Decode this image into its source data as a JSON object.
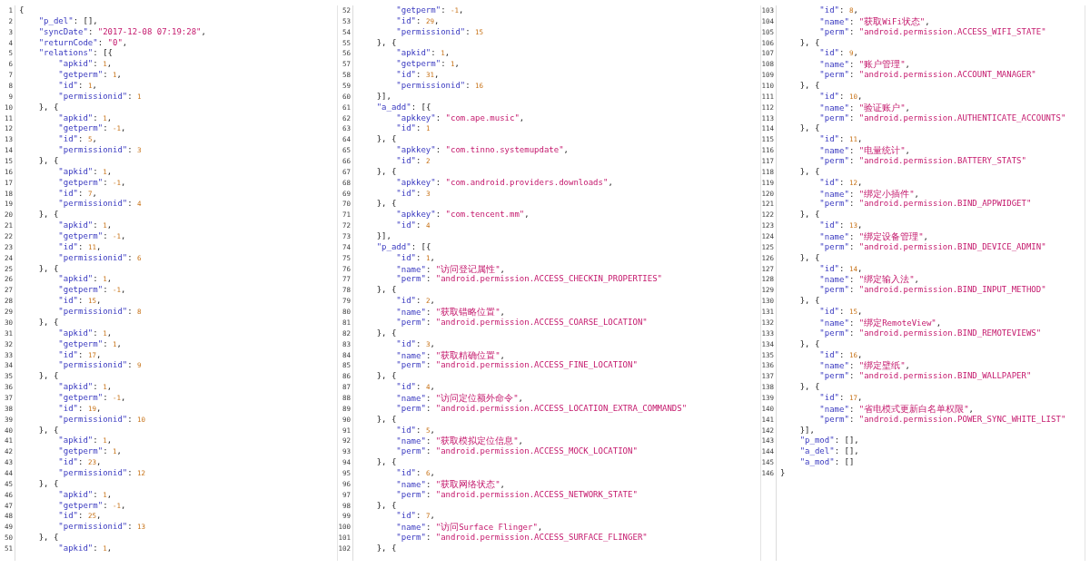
{
  "panes": [
    {
      "lines": [
        {
          "number": "1",
          "code": "{"
        },
        {
          "number": "2",
          "code": "    \"p_del\": [],"
        },
        {
          "number": "3",
          "code": "    \"syncDate\": \"2017-12-08 07:19:28\","
        },
        {
          "number": "4",
          "code": "    \"returnCode\": \"0\","
        },
        {
          "number": "5",
          "code": "    \"relations\": [{"
        },
        {
          "number": "6",
          "code": "        \"apkid\": 1,"
        },
        {
          "number": "7",
          "code": "        \"getperm\": 1,"
        },
        {
          "number": "8",
          "code": "        \"id\": 1,"
        },
        {
          "number": "9",
          "code": "        \"permissionid\": 1"
        },
        {
          "number": "10",
          "code": "    }, {"
        },
        {
          "number": "11",
          "code": "        \"apkid\": 1,"
        },
        {
          "number": "12",
          "code": "        \"getperm\": -1,"
        },
        {
          "number": "13",
          "code": "        \"id\": 5,"
        },
        {
          "number": "14",
          "code": "        \"permissionid\": 3"
        },
        {
          "number": "15",
          "code": "    }, {"
        },
        {
          "number": "16",
          "code": "        \"apkid\": 1,"
        },
        {
          "number": "17",
          "code": "        \"getperm\": -1,"
        },
        {
          "number": "18",
          "code": "        \"id\": 7,"
        },
        {
          "number": "19",
          "code": "        \"permissionid\": 4"
        },
        {
          "number": "20",
          "code": "    }, {"
        },
        {
          "number": "21",
          "code": "        \"apkid\": 1,"
        },
        {
          "number": "22",
          "code": "        \"getperm\": -1,"
        },
        {
          "number": "23",
          "code": "        \"id\": 11,"
        },
        {
          "number": "24",
          "code": "        \"permissionid\": 6"
        },
        {
          "number": "25",
          "code": "    }, {"
        },
        {
          "number": "26",
          "code": "        \"apkid\": 1,"
        },
        {
          "number": "27",
          "code": "        \"getperm\": -1,"
        },
        {
          "number": "28",
          "code": "        \"id\": 15,"
        },
        {
          "number": "29",
          "code": "        \"permissionid\": 8"
        },
        {
          "number": "30",
          "code": "    }, {"
        },
        {
          "number": "31",
          "code": "        \"apkid\": 1,"
        },
        {
          "number": "32",
          "code": "        \"getperm\": 1,"
        },
        {
          "number": "33",
          "code": "        \"id\": 17,"
        },
        {
          "number": "34",
          "code": "        \"permissionid\": 9"
        },
        {
          "number": "35",
          "code": "    }, {"
        },
        {
          "number": "36",
          "code": "        \"apkid\": 1,"
        },
        {
          "number": "37",
          "code": "        \"getperm\": -1,"
        },
        {
          "number": "38",
          "code": "        \"id\": 19,"
        },
        {
          "number": "39",
          "code": "        \"permissionid\": 10"
        },
        {
          "number": "40",
          "code": "    }, {"
        },
        {
          "number": "41",
          "code": "        \"apkid\": 1,"
        },
        {
          "number": "42",
          "code": "        \"getperm\": 1,"
        },
        {
          "number": "43",
          "code": "        \"id\": 23,"
        },
        {
          "number": "44",
          "code": "        \"permissionid\": 12"
        },
        {
          "number": "45",
          "code": "    }, {"
        },
        {
          "number": "46",
          "code": "        \"apkid\": 1,"
        },
        {
          "number": "47",
          "code": "        \"getperm\": -1,"
        },
        {
          "number": "48",
          "code": "        \"id\": 25,"
        },
        {
          "number": "49",
          "code": "        \"permissionid\": 13"
        },
        {
          "number": "50",
          "code": "    }, {"
        },
        {
          "number": "51",
          "code": "        \"apkid\": 1,"
        }
      ]
    },
    {
      "lines": [
        {
          "number": "52",
          "code": "        \"getperm\": -1,"
        },
        {
          "number": "53",
          "code": "        \"id\": 29,"
        },
        {
          "number": "54",
          "code": "        \"permissionid\": 15"
        },
        {
          "number": "55",
          "code": "    }, {"
        },
        {
          "number": "56",
          "code": "        \"apkid\": 1,"
        },
        {
          "number": "57",
          "code": "        \"getperm\": 1,"
        },
        {
          "number": "58",
          "code": "        \"id\": 31,"
        },
        {
          "number": "59",
          "code": "        \"permissionid\": 16"
        },
        {
          "number": "60",
          "code": "    }],"
        },
        {
          "number": "61",
          "code": "    \"a_add\": [{"
        },
        {
          "number": "62",
          "code": "        \"apkkey\": \"com.ape.music\","
        },
        {
          "number": "63",
          "code": "        \"id\": 1"
        },
        {
          "number": "64",
          "code": "    }, {"
        },
        {
          "number": "65",
          "code": "        \"apkkey\": \"com.tinno.systemupdate\","
        },
        {
          "number": "66",
          "code": "        \"id\": 2"
        },
        {
          "number": "67",
          "code": "    }, {"
        },
        {
          "number": "68",
          "code": "        \"apkkey\": \"com.android.providers.downloads\","
        },
        {
          "number": "69",
          "code": "        \"id\": 3"
        },
        {
          "number": "70",
          "code": "    }, {"
        },
        {
          "number": "71",
          "code": "        \"apkkey\": \"com.tencent.mm\","
        },
        {
          "number": "72",
          "code": "        \"id\": 4"
        },
        {
          "number": "73",
          "code": "    }],"
        },
        {
          "number": "74",
          "code": "    \"p_add\": [{"
        },
        {
          "number": "75",
          "code": "        \"id\": 1,"
        },
        {
          "number": "76",
          "code": "        \"name\": \"访问登记属性\","
        },
        {
          "number": "77",
          "code": "        \"perm\": \"android.permission.ACCESS_CHECKIN_PROPERTIES\""
        },
        {
          "number": "78",
          "code": "    }, {"
        },
        {
          "number": "79",
          "code": "        \"id\": 2,"
        },
        {
          "number": "80",
          "code": "        \"name\": \"获取错略位置\","
        },
        {
          "number": "81",
          "code": "        \"perm\": \"android.permission.ACCESS_COARSE_LOCATION\""
        },
        {
          "number": "82",
          "code": "    }, {"
        },
        {
          "number": "83",
          "code": "        \"id\": 3,"
        },
        {
          "number": "84",
          "code": "        \"name\": \"获取精确位置\","
        },
        {
          "number": "85",
          "code": "        \"perm\": \"android.permission.ACCESS_FINE_LOCATION\""
        },
        {
          "number": "86",
          "code": "    }, {"
        },
        {
          "number": "87",
          "code": "        \"id\": 4,"
        },
        {
          "number": "88",
          "code": "        \"name\": \"访问定位额外命令\","
        },
        {
          "number": "89",
          "code": "        \"perm\": \"android.permission.ACCESS_LOCATION_EXTRA_COMMANDS\""
        },
        {
          "number": "90",
          "code": "    }, {"
        },
        {
          "number": "91",
          "code": "        \"id\": 5,"
        },
        {
          "number": "92",
          "code": "        \"name\": \"获取模拟定位信息\","
        },
        {
          "number": "93",
          "code": "        \"perm\": \"android.permission.ACCESS_MOCK_LOCATION\""
        },
        {
          "number": "94",
          "code": "    }, {"
        },
        {
          "number": "95",
          "code": "        \"id\": 6,"
        },
        {
          "number": "96",
          "code": "        \"name\": \"获取网络状态\","
        },
        {
          "number": "97",
          "code": "        \"perm\": \"android.permission.ACCESS_NETWORK_STATE\""
        },
        {
          "number": "98",
          "code": "    }, {"
        },
        {
          "number": "99",
          "code": "        \"id\": 7,"
        },
        {
          "number": "100",
          "code": "        \"name\": \"访问Surface Flinger\","
        },
        {
          "number": "101",
          "code": "        \"perm\": \"android.permission.ACCESS_SURFACE_FLINGER\""
        },
        {
          "number": "102",
          "code": "    }, {"
        }
      ]
    },
    {
      "lines": [
        {
          "number": "103",
          "code": "        \"id\": 8,"
        },
        {
          "number": "104",
          "code": "        \"name\": \"获取WiFi状态\","
        },
        {
          "number": "105",
          "code": "        \"perm\": \"android.permission.ACCESS_WIFI_STATE\""
        },
        {
          "number": "106",
          "code": "    }, {"
        },
        {
          "number": "107",
          "code": "        \"id\": 9,"
        },
        {
          "number": "108",
          "code": "        \"name\": \"账户管理\","
        },
        {
          "number": "109",
          "code": "        \"perm\": \"android.permission.ACCOUNT_MANAGER\""
        },
        {
          "number": "110",
          "code": "    }, {"
        },
        {
          "number": "111",
          "code": "        \"id\": 10,"
        },
        {
          "number": "112",
          "code": "        \"name\": \"验证账户\","
        },
        {
          "number": "113",
          "code": "        \"perm\": \"android.permission.AUTHENTICATE_ACCOUNTS\""
        },
        {
          "number": "114",
          "code": "    }, {"
        },
        {
          "number": "115",
          "code": "        \"id\": 11,"
        },
        {
          "number": "116",
          "code": "        \"name\": \"电量统计\","
        },
        {
          "number": "117",
          "code": "        \"perm\": \"android.permission.BATTERY_STATS\""
        },
        {
          "number": "118",
          "code": "    }, {"
        },
        {
          "number": "119",
          "code": "        \"id\": 12,"
        },
        {
          "number": "120",
          "code": "        \"name\": \"绑定小插件\","
        },
        {
          "number": "121",
          "code": "        \"perm\": \"android.permission.BIND_APPWIDGET\""
        },
        {
          "number": "122",
          "code": "    }, {"
        },
        {
          "number": "123",
          "code": "        \"id\": 13,"
        },
        {
          "number": "124",
          "code": "        \"name\": \"绑定设备管理\","
        },
        {
          "number": "125",
          "code": "        \"perm\": \"android.permission.BIND_DEVICE_ADMIN\""
        },
        {
          "number": "126",
          "code": "    }, {"
        },
        {
          "number": "127",
          "code": "        \"id\": 14,"
        },
        {
          "number": "128",
          "code": "        \"name\": \"绑定输入法\","
        },
        {
          "number": "129",
          "code": "        \"perm\": \"android.permission.BIND_INPUT_METHOD\""
        },
        {
          "number": "130",
          "code": "    }, {"
        },
        {
          "number": "131",
          "code": "        \"id\": 15,"
        },
        {
          "number": "132",
          "code": "        \"name\": \"绑定RemoteView\","
        },
        {
          "number": "133",
          "code": "        \"perm\": \"android.permission.BIND_REMOTEVIEWS\""
        },
        {
          "number": "134",
          "code": "    }, {"
        },
        {
          "number": "135",
          "code": "        \"id\": 16,"
        },
        {
          "number": "136",
          "code": "        \"name\": \"绑定壁纸\","
        },
        {
          "number": "137",
          "code": "        \"perm\": \"android.permission.BIND_WALLPAPER\""
        },
        {
          "number": "138",
          "code": "    }, {"
        },
        {
          "number": "139",
          "code": "        \"id\": 17,"
        },
        {
          "number": "140",
          "code": "        \"name\": \"省电模式更新白名单权限\","
        },
        {
          "number": "141",
          "code": "        \"perm\": \"android.permission.POWER_SYNC_WHITE_LIST\""
        },
        {
          "number": "142",
          "code": "    }],"
        },
        {
          "number": "143",
          "code": "    \"p_mod\": [],"
        },
        {
          "number": "144",
          "code": "    \"a_del\": [],"
        },
        {
          "number": "145",
          "code": "    \"a_mod\": []"
        },
        {
          "number": "146",
          "code": "}"
        }
      ]
    }
  ]
}
